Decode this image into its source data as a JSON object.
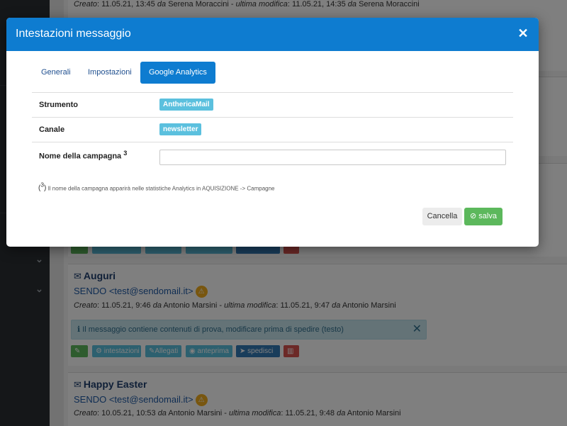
{
  "background": {
    "top_meta": {
      "created_label": "Creato",
      "created_value": "11.05.21, 13:45",
      "by1": "da",
      "author1": "Serena Moraccini",
      "sep": " - ",
      "modified_label": "ultima modifica",
      "modified_value": "11.05.21, 14:35",
      "by2": "da",
      "author2": "Serena Moraccini"
    },
    "messages": [
      {
        "title": "Auguri",
        "sender": "SENDO <test@sendomail.it>",
        "created_label": "Creato",
        "created_value": "11.05.21, 9:46",
        "by1": "da",
        "author1": "Antonio Marsini",
        "sep": " - ",
        "modified_label": "ultima modifica",
        "modified_value": "11.05.21, 9:47",
        "by2": "da",
        "author2": "Antonio Marsini",
        "alert": "Il messaggio contiene contenuti di prova, modificare prima di spedire (testo)",
        "buttons": {
          "headers": "intestazioni",
          "attachments": "Allegati",
          "preview": "anteprima",
          "send": "spedisci"
        }
      },
      {
        "title": "Happy Easter",
        "sender": "SENDO <test@sendomail.it>",
        "created_label": "Creato",
        "created_value": "10.05.21, 10:53",
        "by1": "da",
        "author1": "Antonio Marsini",
        "sep": " - ",
        "modified_label": "ultima modifica",
        "modified_value": "11.05.21, 9:48",
        "by2": "da",
        "author2": "Antonio Marsini"
      }
    ]
  },
  "modal": {
    "title": "Intestazioni messaggio",
    "close_glyph": "✕",
    "tabs": [
      {
        "label": "Generali",
        "active": false
      },
      {
        "label": "Impostazioni",
        "active": false
      },
      {
        "label": "Google Analytics",
        "active": true
      }
    ],
    "fields": {
      "tool_label": "Strumento",
      "tool_value": "AnthericaMail",
      "channel_label": "Canale",
      "channel_value": "newsletter",
      "campaign_label": "Nome della campagna",
      "campaign_sup": "3",
      "campaign_value": "",
      "campaign_placeholder": ""
    },
    "footnote_ref": "3",
    "footnote_text": "Il nome della campagna apparirà nelle statistiche Analytics in AQUISIZIONE -> Campagne",
    "cancel_label": "Cancella",
    "save_label": "salva"
  },
  "icons": {
    "close": "close-icon",
    "envelope": "envelope-icon",
    "warning": "warning-icon",
    "info": "info-icon",
    "check_circle": "check-circle-icon",
    "edit": "edit-icon",
    "gear": "gear-icon",
    "paperclip": "paperclip-icon",
    "eye": "eye-icon",
    "send": "send-icon",
    "trash": "trash-icon",
    "chevron_down": "chevron-down-icon"
  },
  "colors": {
    "primary": "#0e7cd0",
    "info_badge": "#5bc0de",
    "success": "#5cb85c",
    "danger": "#d9534f",
    "warning": "#f0ad1e"
  }
}
